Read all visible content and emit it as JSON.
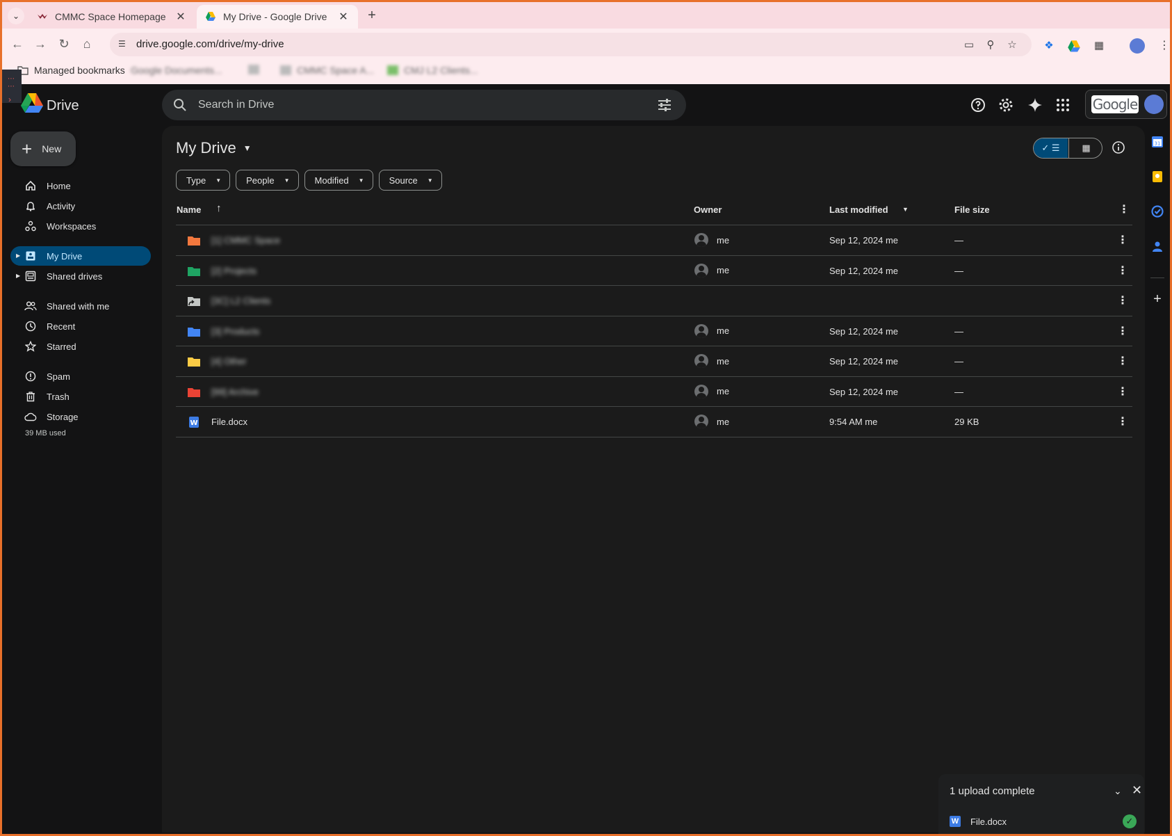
{
  "browser": {
    "tabs": [
      {
        "title": "CMMC Space Homepage",
        "active": false
      },
      {
        "title": "My Drive - Google Drive",
        "active": true
      }
    ],
    "url": "drive.google.com/drive/my-drive",
    "bookmarks": {
      "managed": "Managed bookmarks",
      "items": [
        "Google Documents...",
        "CMMC Space A...",
        "CMJ L2 Clients..."
      ]
    }
  },
  "drive": {
    "logo_text": "Drive",
    "search_placeholder": "Search in Drive",
    "account_logo": "Google",
    "new_label": "New",
    "nav": [
      {
        "label": "Home",
        "icon": "home-icon"
      },
      {
        "label": "Activity",
        "icon": "bell-icon"
      },
      {
        "label": "Workspaces",
        "icon": "workspaces-icon"
      },
      {
        "label": "My Drive",
        "icon": "my-drive-icon",
        "selected": true
      },
      {
        "label": "Shared drives",
        "icon": "shared-drives-icon"
      },
      {
        "label": "Shared with me",
        "icon": "people-icon"
      },
      {
        "label": "Recent",
        "icon": "clock-icon"
      },
      {
        "label": "Starred",
        "icon": "star-icon"
      },
      {
        "label": "Spam",
        "icon": "spam-icon"
      },
      {
        "label": "Trash",
        "icon": "trash-icon"
      },
      {
        "label": "Storage",
        "icon": "cloud-icon"
      }
    ],
    "storage_used": "39 MB used",
    "main_title": "My Drive",
    "filters": [
      "Type",
      "People",
      "Modified",
      "Source"
    ],
    "columns": {
      "name": "Name",
      "owner": "Owner",
      "modified": "Last modified",
      "size": "File size"
    },
    "rows": [
      {
        "name": "[1] CMMC Space",
        "owner": "me",
        "modified": "Sep 12, 2024 me",
        "size": "—",
        "color": "#f2783e",
        "blurred": true,
        "kind": "folder"
      },
      {
        "name": "[2] Projects",
        "owner": "me",
        "modified": "Sep 12, 2024 me",
        "size": "—",
        "color": "#1fa463",
        "blurred": true,
        "kind": "folder"
      },
      {
        "name": "[3C] L2 Clients",
        "owner": "",
        "modified": "",
        "size": "",
        "color": "#c4c7c5",
        "blurred": true,
        "kind": "shortcut"
      },
      {
        "name": "[3] Products",
        "owner": "me",
        "modified": "Sep 12, 2024 me",
        "size": "—",
        "color": "#4285f4",
        "blurred": true,
        "kind": "folder"
      },
      {
        "name": "[4] Other",
        "owner": "me",
        "modified": "Sep 12, 2024 me",
        "size": "—",
        "color": "#fbcb45",
        "blurred": true,
        "kind": "folder"
      },
      {
        "name": "[99] Archive",
        "owner": "me",
        "modified": "Sep 12, 2024 me",
        "size": "—",
        "color": "#ea4335",
        "blurred": true,
        "kind": "folder"
      },
      {
        "name": "File.docx",
        "owner": "me",
        "modified": "9:54 AM me",
        "size": "29 KB",
        "color": "#3c7be4",
        "blurred": false,
        "kind": "doc"
      }
    ],
    "upload": {
      "title": "1 upload complete",
      "file": "File.docx"
    }
  }
}
